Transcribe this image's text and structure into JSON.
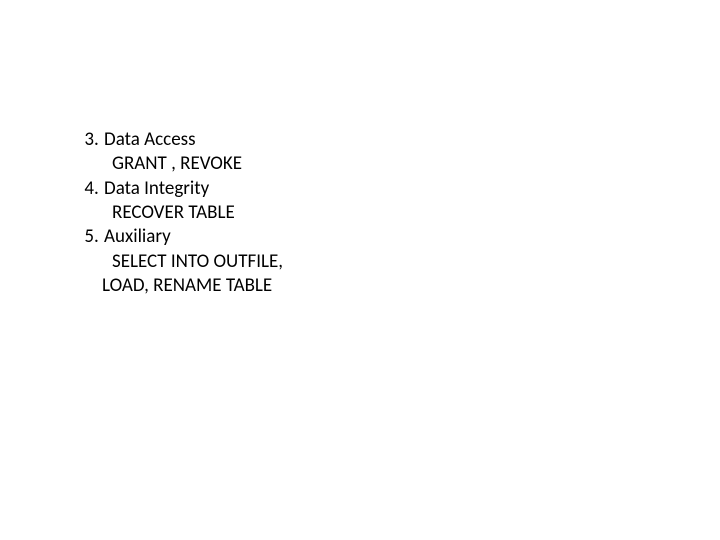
{
  "items": [
    {
      "number": "3",
      "title": "Data Access",
      "sub": [
        "GRANT , REVOKE "
      ]
    },
    {
      "number": "4",
      "title": "Data Integrity",
      "sub": [
        "RECOVER TABLE"
      ]
    },
    {
      "number": "5",
      "title": "Auxiliary",
      "sub": [
        "SELECT INTO OUTFILE,"
      ],
      "subless": [
        "LOAD, RENAME TABLE "
      ]
    }
  ]
}
